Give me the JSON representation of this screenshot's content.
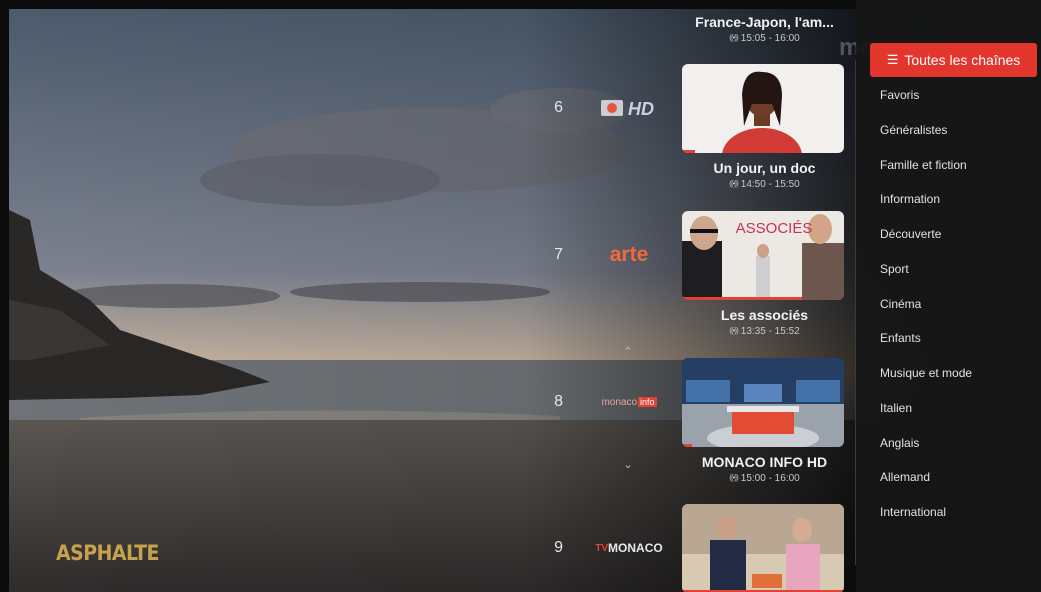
{
  "player": {
    "show_logo": "ASPHALTE",
    "watermark": "mo"
  },
  "top_program": {
    "title": "France-Japon, l'am...",
    "time": "15:05 - 16:00"
  },
  "channels": [
    {
      "number": "6",
      "logo_name": "m6-hd-logo",
      "program_title": "Un jour, un doc",
      "program_time": "14:50 - 15:50",
      "progress": 0.08
    },
    {
      "number": "7",
      "logo_text": "arte",
      "logo_name": "arte-logo",
      "program_title": "Les associés",
      "program_time": "13:35 - 15:52",
      "poster_text": "ASSOCIÉS",
      "progress": 0.74
    },
    {
      "number": "8",
      "logo_text_1": "monaco",
      "logo_text_2": "info",
      "logo_name": "monaco-info-logo",
      "program_title": "MONACO INFO HD",
      "program_time": "15:00 - 16:00",
      "progress": 0.06
    },
    {
      "number": "9",
      "logo_text_1": "TV",
      "logo_text_2": "MONACO",
      "logo_name": "tv-monaco-logo",
      "progress": 1.0
    }
  ],
  "sidebar": {
    "all_channels_label": "Toutes les chaînes",
    "categories": [
      "Favoris",
      "Généralistes",
      "Famille et fiction",
      "Information",
      "Découverte",
      "Sport",
      "Cinéma",
      "Enfants",
      "Musique et mode",
      "Italien",
      "Anglais",
      "Allemand",
      "International"
    ]
  },
  "colors": {
    "accent": "#e2362d",
    "progress": "#e24232",
    "panel": "#161616",
    "show_logo": "#c7a24c"
  },
  "icons": {
    "live": "broadcast-icon",
    "list": "list-icon",
    "up": "chevron-up-icon",
    "down": "chevron-down-icon"
  }
}
